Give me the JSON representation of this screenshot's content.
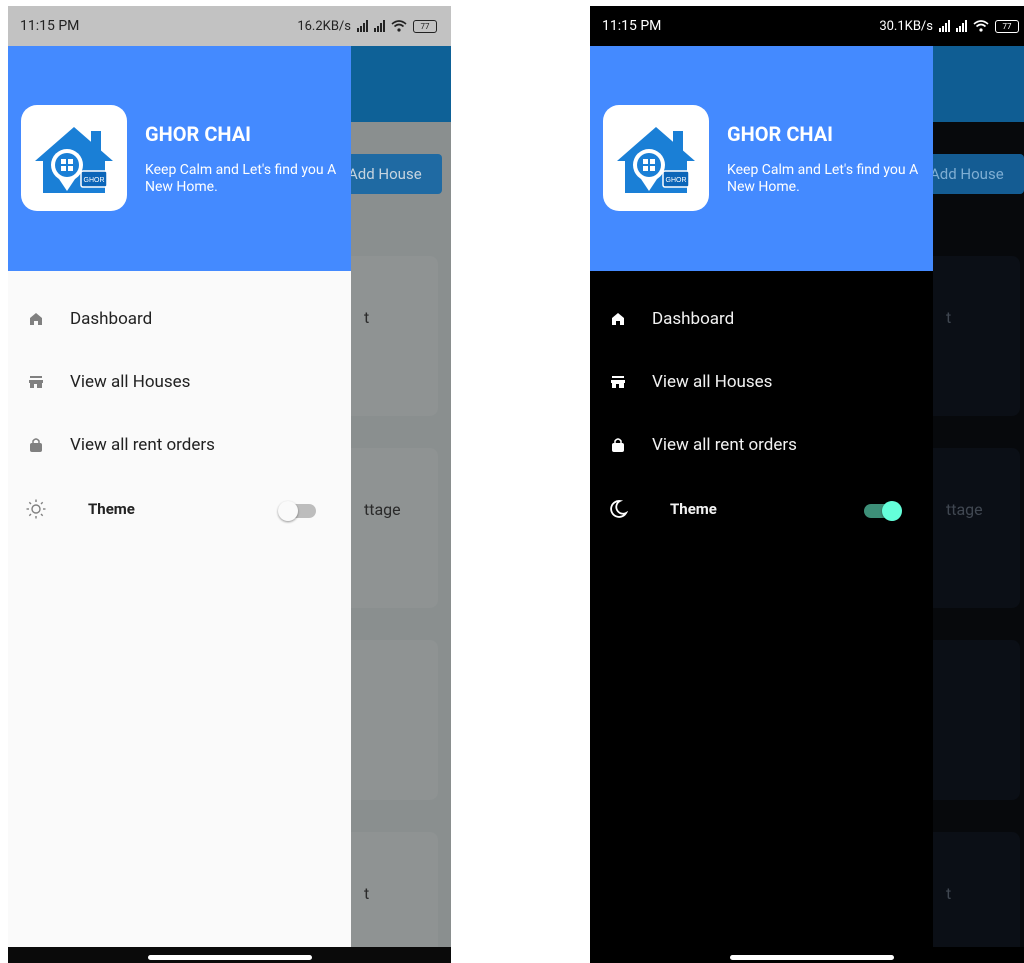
{
  "screens": [
    {
      "mode": "light",
      "status": {
        "time": "11:15 PM",
        "speed": "16.2KB/s",
        "battery": "77"
      },
      "background": {
        "add_button": "Add House",
        "card_texts": [
          "t",
          "ttage",
          "t"
        ]
      },
      "drawer": {
        "app_title": "GHOR CHAI",
        "app_subtitle": "Keep Calm and Let's find you A New Home.",
        "logo_badge": "GHOR",
        "items": [
          {
            "label": "Dashboard",
            "icon": "home-icon"
          },
          {
            "label": "View all Houses",
            "icon": "store-icon"
          },
          {
            "label": "View all rent orders",
            "icon": "shopping-bag-icon"
          }
        ],
        "theme": {
          "label": "Theme",
          "icon": "sun-icon",
          "enabled": false
        }
      }
    },
    {
      "mode": "dark",
      "status": {
        "time": "11:15 PM",
        "speed": "30.1KB/s",
        "battery": "77"
      },
      "background": {
        "add_button": "Add House",
        "card_texts": [
          "t",
          "ttage",
          "t"
        ]
      },
      "drawer": {
        "app_title": "GHOR CHAI",
        "app_subtitle": "Keep Calm and Let's find you A New Home.",
        "logo_badge": "GHOR",
        "items": [
          {
            "label": "Dashboard",
            "icon": "home-icon"
          },
          {
            "label": "View all Houses",
            "icon": "store-icon"
          },
          {
            "label": "View all rent orders",
            "icon": "shopping-bag-icon"
          }
        ],
        "theme": {
          "label": "Theme",
          "icon": "moon-icon",
          "enabled": true
        }
      }
    }
  ],
  "colors": {
    "drawer_header": "#448aff",
    "app_bar": "#0e6197",
    "toggle_on": "#64ffda"
  }
}
